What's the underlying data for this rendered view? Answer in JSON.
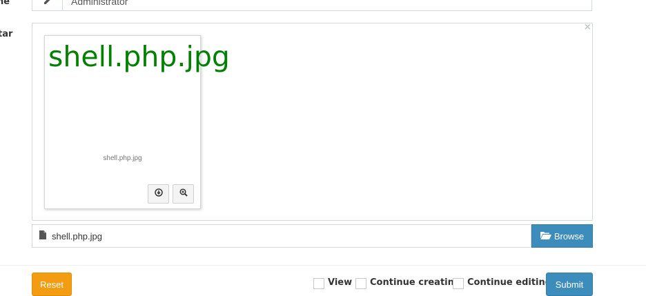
{
  "form": {
    "name_label": "ne",
    "name_value": "Administrator",
    "avatar_label": "tar"
  },
  "preview": {
    "close_symbol": "×",
    "big_text": "shell.php.jpg",
    "caption": "shell.php.jpg",
    "big_text_color": "#008000"
  },
  "file_input": {
    "filename": "shell.php.jpg",
    "browse_label": "Browse",
    "browse_color": "#3c8dbc"
  },
  "footer": {
    "reset_label": "Reset",
    "reset_color": "#f39c12",
    "view_label": "View",
    "continue_creating_label": "Continue creating",
    "continue_editing_label": "Continue editing",
    "submit_label": "Submit",
    "submit_color": "#3c8dbc"
  },
  "icons": {
    "name_addon": "pencil-icon",
    "download": "download-icon",
    "zoom": "zoom-icon",
    "file": "file-icon",
    "folder": "folder-open-icon"
  }
}
